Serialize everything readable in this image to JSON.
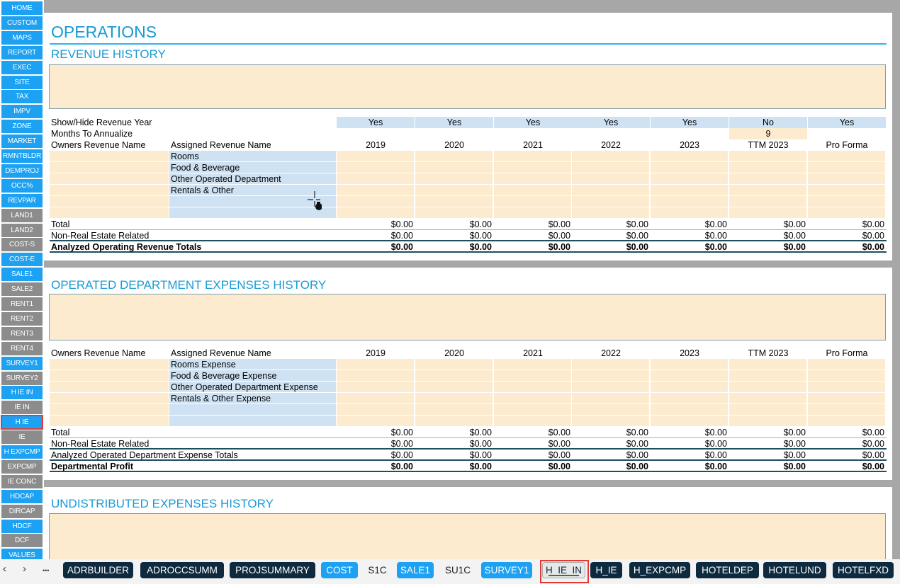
{
  "sidebar": {
    "items": [
      {
        "label": "HOME",
        "style": "blue"
      },
      {
        "label": "CUSTOM",
        "style": "blue"
      },
      {
        "label": "MAPS",
        "style": "blue"
      },
      {
        "label": "REPORT",
        "style": "blue"
      },
      {
        "label": "EXEC",
        "style": "blue"
      },
      {
        "label": "SITE",
        "style": "blue"
      },
      {
        "label": "TAX",
        "style": "blue"
      },
      {
        "label": "IMPV",
        "style": "blue"
      },
      {
        "label": "ZONE",
        "style": "blue"
      },
      {
        "label": "MARKET",
        "style": "blue"
      },
      {
        "label": "RMNTBLDR",
        "style": "blue"
      },
      {
        "label": "DEMPROJ",
        "style": "blue"
      },
      {
        "label": "OCC%",
        "style": "blue"
      },
      {
        "label": "REVPAR",
        "style": "blue"
      },
      {
        "label": "LAND1",
        "style": "gray"
      },
      {
        "label": "LAND2",
        "style": "gray"
      },
      {
        "label": "COST-S",
        "style": "gray"
      },
      {
        "label": "COST-E",
        "style": "blue"
      },
      {
        "label": "SALE1",
        "style": "blue"
      },
      {
        "label": "SALE2",
        "style": "gray"
      },
      {
        "label": "RENT1",
        "style": "gray"
      },
      {
        "label": "RENT2",
        "style": "gray"
      },
      {
        "label": "RENT3",
        "style": "gray"
      },
      {
        "label": "RENT4",
        "style": "gray"
      },
      {
        "label": "SURVEY1",
        "style": "blue"
      },
      {
        "label": "SURVEY2",
        "style": "gray"
      },
      {
        "label": "H IE IN",
        "style": "blue"
      },
      {
        "label": "IE IN",
        "style": "gray"
      },
      {
        "label": "H IE",
        "style": "selected"
      },
      {
        "label": "IE",
        "style": "gray"
      },
      {
        "label": "H EXPCMP",
        "style": "blue"
      },
      {
        "label": "EXPCMP",
        "style": "gray"
      },
      {
        "label": "IE CONC",
        "style": "gray"
      },
      {
        "label": "HDCAP",
        "style": "blue"
      },
      {
        "label": "DIRCAP",
        "style": "gray"
      },
      {
        "label": "HDCF",
        "style": "blue"
      },
      {
        "label": "DCF",
        "style": "gray"
      },
      {
        "label": "VALUES",
        "style": "blue"
      }
    ]
  },
  "page_title": "OPERATIONS",
  "revenue": {
    "title": "REVENUE HISTORY",
    "show_hide_label": "Show/Hide Revenue Year",
    "show_hide_values": [
      "Yes",
      "Yes",
      "Yes",
      "Yes",
      "Yes",
      "No",
      "Yes"
    ],
    "months_label": "Months To Annualize",
    "months_value": "9",
    "owners_header": "Owners Revenue Name",
    "assigned_header": "Assigned Revenue Name",
    "years": [
      "2019",
      "2020",
      "2021",
      "2022",
      "2023",
      "TTM 2023",
      "Pro Forma"
    ],
    "items": [
      "Rooms",
      "Food & Beverage",
      "Other Operated Department",
      "Rentals & Other",
      "",
      ""
    ],
    "total_label": "Total",
    "total_values": [
      "$0.00",
      "$0.00",
      "$0.00",
      "$0.00",
      "$0.00",
      "$0.00",
      "$0.00"
    ],
    "nre_label": "Non-Real Estate Related",
    "nre_values": [
      "$0.00",
      "$0.00",
      "$0.00",
      "$0.00",
      "$0.00",
      "$0.00",
      "$0.00"
    ],
    "analyzed_label": "Analyzed Operating Revenue Totals",
    "analyzed_values": [
      "$0.00",
      "$0.00",
      "$0.00",
      "$0.00",
      "$0.00",
      "$0.00",
      "$0.00"
    ]
  },
  "expenses": {
    "title": "OPERATED DEPARTMENT EXPENSES HISTORY",
    "owners_header": "Owners Revenue Name",
    "assigned_header": "Assigned Revenue Name",
    "years": [
      "2019",
      "2020",
      "2021",
      "2022",
      "2023",
      "TTM 2023",
      "Pro Forma"
    ],
    "items": [
      "Rooms Expense",
      "Food & Beverage Expense",
      "Other Operated Department Expense",
      "Rentals & Other Expense",
      "",
      ""
    ],
    "total_label": "Total",
    "total_values": [
      "$0.00",
      "$0.00",
      "$0.00",
      "$0.00",
      "$0.00",
      "$0.00",
      "$0.00"
    ],
    "nre_label": "Non-Real Estate Related",
    "nre_values": [
      "$0.00",
      "$0.00",
      "$0.00",
      "$0.00",
      "$0.00",
      "$0.00",
      "$0.00"
    ],
    "analyzed_label": "Analyzed Operated Department Expense Totals",
    "analyzed_values": [
      "$0.00",
      "$0.00",
      "$0.00",
      "$0.00",
      "$0.00",
      "$0.00",
      "$0.00"
    ],
    "profit_label": "Departmental Profit",
    "profit_values": [
      "$0.00",
      "$0.00",
      "$0.00",
      "$0.00",
      "$0.00",
      "$0.00",
      "$0.00"
    ]
  },
  "undistributed": {
    "title": "UNDISTRIBUTED EXPENSES HISTORY"
  },
  "tabs": {
    "prev_icon": "‹",
    "next_icon": "›",
    "more_icon": "•••",
    "items": [
      {
        "label": "ADRBUILDER",
        "style": "dark"
      },
      {
        "label": "ADROCCSUMM",
        "style": "dark"
      },
      {
        "label": "PROJSUMMARY",
        "style": "dark"
      },
      {
        "label": "COST",
        "style": "blue"
      },
      {
        "label": "S1C",
        "style": "plain"
      },
      {
        "label": "SALE1",
        "style": "blue"
      },
      {
        "label": "SU1C",
        "style": "plain"
      },
      {
        "label": "SURVEY1",
        "style": "blue"
      },
      {
        "label": "H_IE_IN",
        "style": "active"
      },
      {
        "label": "H_IE",
        "style": "dark"
      },
      {
        "label": "H_EXPCMP",
        "style": "dark"
      },
      {
        "label": "HOTELDEP",
        "style": "dark"
      },
      {
        "label": "HOTELUND",
        "style": "dark"
      },
      {
        "label": "HOTELFXD",
        "style": "dark"
      }
    ]
  }
}
